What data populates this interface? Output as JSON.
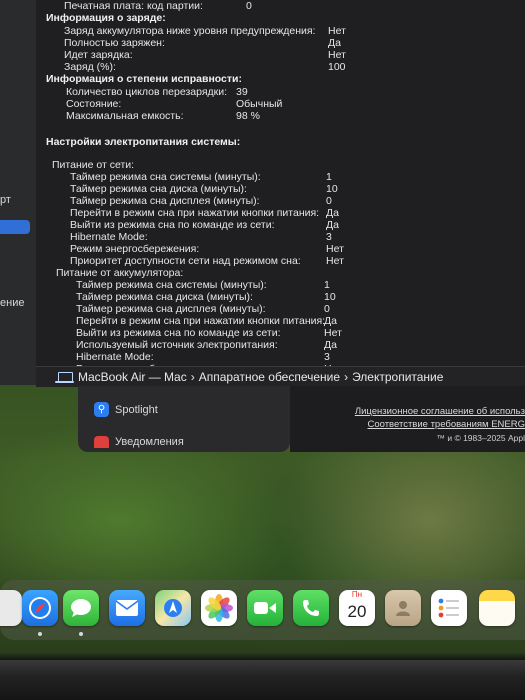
{
  "sidebar": {
    "frag1": "рт",
    "frag2": "ение"
  },
  "info": {
    "top_row": {
      "label": "Печатная плата: код партии:",
      "value": "0"
    },
    "charge_header": "Информация о заряде:",
    "charge_rows": [
      {
        "label": "Заряд аккумулятора ниже уровня предупреждения:",
        "value": "Нет"
      },
      {
        "label": "Полностью заряжен:",
        "value": "Да"
      },
      {
        "label": "Идет зарядка:",
        "value": "Нет"
      },
      {
        "label": "Заряд (%):",
        "value": "100"
      }
    ],
    "health_header": "Информация о степени исправности:",
    "health_rows": [
      {
        "label": "Количество циклов перезарядки:",
        "value": "39"
      },
      {
        "label": "Состояние:",
        "value": "Обычный"
      },
      {
        "label": "Максимальная емкость:",
        "value": "98 %"
      }
    ],
    "power_settings_header": "Настройки электропитания системы:",
    "ac_header": "Питание от сети:",
    "ac_rows": [
      {
        "label": "Таймер режима сна системы (минуты):",
        "value": "1"
      },
      {
        "label": "Таймер режима сна диска (минуты):",
        "value": "10"
      },
      {
        "label": "Таймер режима сна дисплея (минуты):",
        "value": "0"
      },
      {
        "label": "Перейти в режим сна при нажатии кнопки питания:",
        "value": "Да"
      },
      {
        "label": "Выйти из режима сна по команде из сети:",
        "value": "Да"
      },
      {
        "label": "Hibernate Mode:",
        "value": "3"
      },
      {
        "label": "Режим энергосбережения:",
        "value": "Нет"
      },
      {
        "label": "Приоритет доступности сети над режимом сна:",
        "value": "Нет"
      }
    ],
    "battery_header": "Питание от аккумулятора:",
    "battery_rows": [
      {
        "label": "Таймер режима сна системы (минуты):",
        "value": "1"
      },
      {
        "label": "Таймер режима сна диска (минуты):",
        "value": "10"
      },
      {
        "label": "Таймер режима сна дисплея (минуты):",
        "value": "0"
      },
      {
        "label": "Перейти в режим сна при нажатии кнопки питания:",
        "value": "Да"
      },
      {
        "label": "Выйти из режима сна по команде из сети:",
        "value": "Нет"
      },
      {
        "label": "Используемый источник электропитания:",
        "value": "Да"
      },
      {
        "label": "Hibernate Mode:",
        "value": "3"
      },
      {
        "label": "Режим энергосбережения:",
        "value": "Нет"
      }
    ]
  },
  "pathbar": {
    "device": "MacBook Air — Mac",
    "sep1": "›",
    "section": "Аппаратное обеспечение",
    "sep2": "›",
    "page": "Электропитание"
  },
  "panel": {
    "spotlight": "Spotlight",
    "notifications": "Уведомления"
  },
  "license": {
    "line1": "Лицензионное соглашение об использ",
    "line2": "Соответствие требованиям ENERG",
    "copyright": "™ и © 1983–2025 Appl"
  },
  "dock": {
    "calendar_month": "Пн",
    "calendar_day": "20",
    "icons": [
      "safari-icon",
      "messages-icon",
      "mail-icon",
      "maps-icon",
      "photos-icon",
      "facetime-icon",
      "phone-icon",
      "calendar-icon",
      "contacts-icon",
      "reminders-icon",
      "notes-icon"
    ]
  },
  "colors": {
    "window_bg": "#1f1f21",
    "accent": "#2f6fd6"
  }
}
